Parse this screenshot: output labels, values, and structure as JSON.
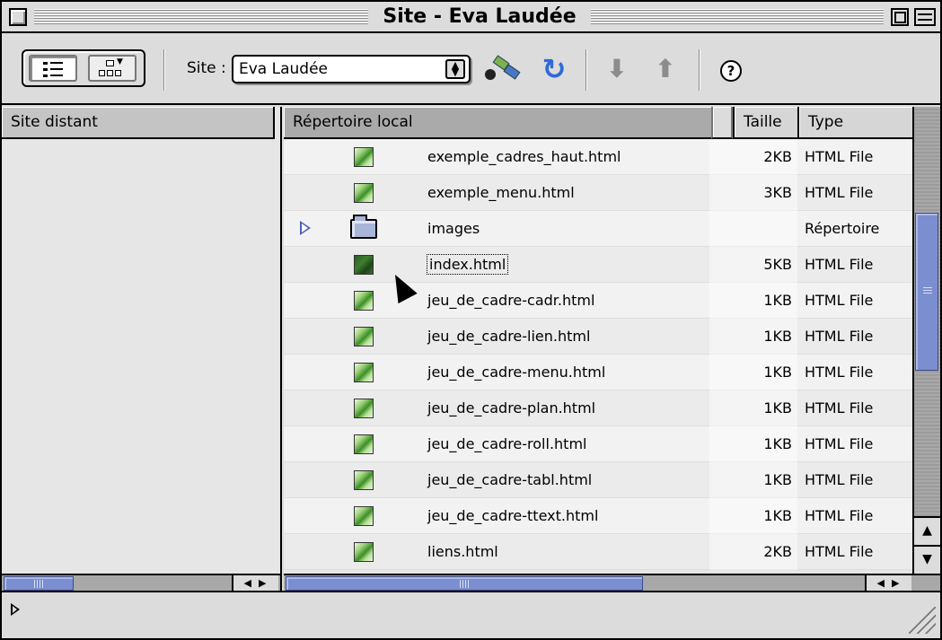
{
  "window": {
    "title": "Site - Eva Laudée"
  },
  "toolbar": {
    "site_label": "Site :",
    "site_selected": "Eva Laudée",
    "help_glyph": "?"
  },
  "remote": {
    "header": "Site distant"
  },
  "local": {
    "header": "Répertoire local",
    "col_size": "Taille",
    "col_type": "Type",
    "rows": [
      {
        "name": "exemple_cadres_haut.html",
        "size": "2KB",
        "type": "HTML File",
        "icon": "html-file-icon"
      },
      {
        "name": "exemple_menu.html",
        "size": "3KB",
        "type": "HTML File",
        "icon": "html-file-icon"
      },
      {
        "name": "images",
        "size": "",
        "type": "Répertoire",
        "icon": "folder-icon"
      },
      {
        "name": "index.html",
        "size": "5KB",
        "type": "HTML File",
        "icon": "html-file-icon"
      },
      {
        "name": "jeu_de_cadre-cadr.html",
        "size": "1KB",
        "type": "HTML File",
        "icon": "html-file-icon"
      },
      {
        "name": "jeu_de_cadre-lien.html",
        "size": "1KB",
        "type": "HTML File",
        "icon": "html-file-icon"
      },
      {
        "name": "jeu_de_cadre-menu.html",
        "size": "1KB",
        "type": "HTML File",
        "icon": "html-file-icon"
      },
      {
        "name": "jeu_de_cadre-plan.html",
        "size": "1KB",
        "type": "HTML File",
        "icon": "html-file-icon"
      },
      {
        "name": "jeu_de_cadre-roll.html",
        "size": "1KB",
        "type": "HTML File",
        "icon": "html-file-icon"
      },
      {
        "name": "jeu_de_cadre-tabl.html",
        "size": "1KB",
        "type": "HTML File",
        "icon": "html-file-icon"
      },
      {
        "name": "jeu_de_cadre-ttext.html",
        "size": "1KB",
        "type": "HTML File",
        "icon": "html-file-icon"
      },
      {
        "name": "liens.html",
        "size": "2KB",
        "type": "HTML File",
        "icon": "html-file-icon"
      }
    ]
  },
  "colors": {
    "scroll_accent": "#7b8ecf",
    "disclosure": "#5060b8",
    "refresh": "#2f6ad8",
    "file_icon_green": "#3c8e2a"
  }
}
